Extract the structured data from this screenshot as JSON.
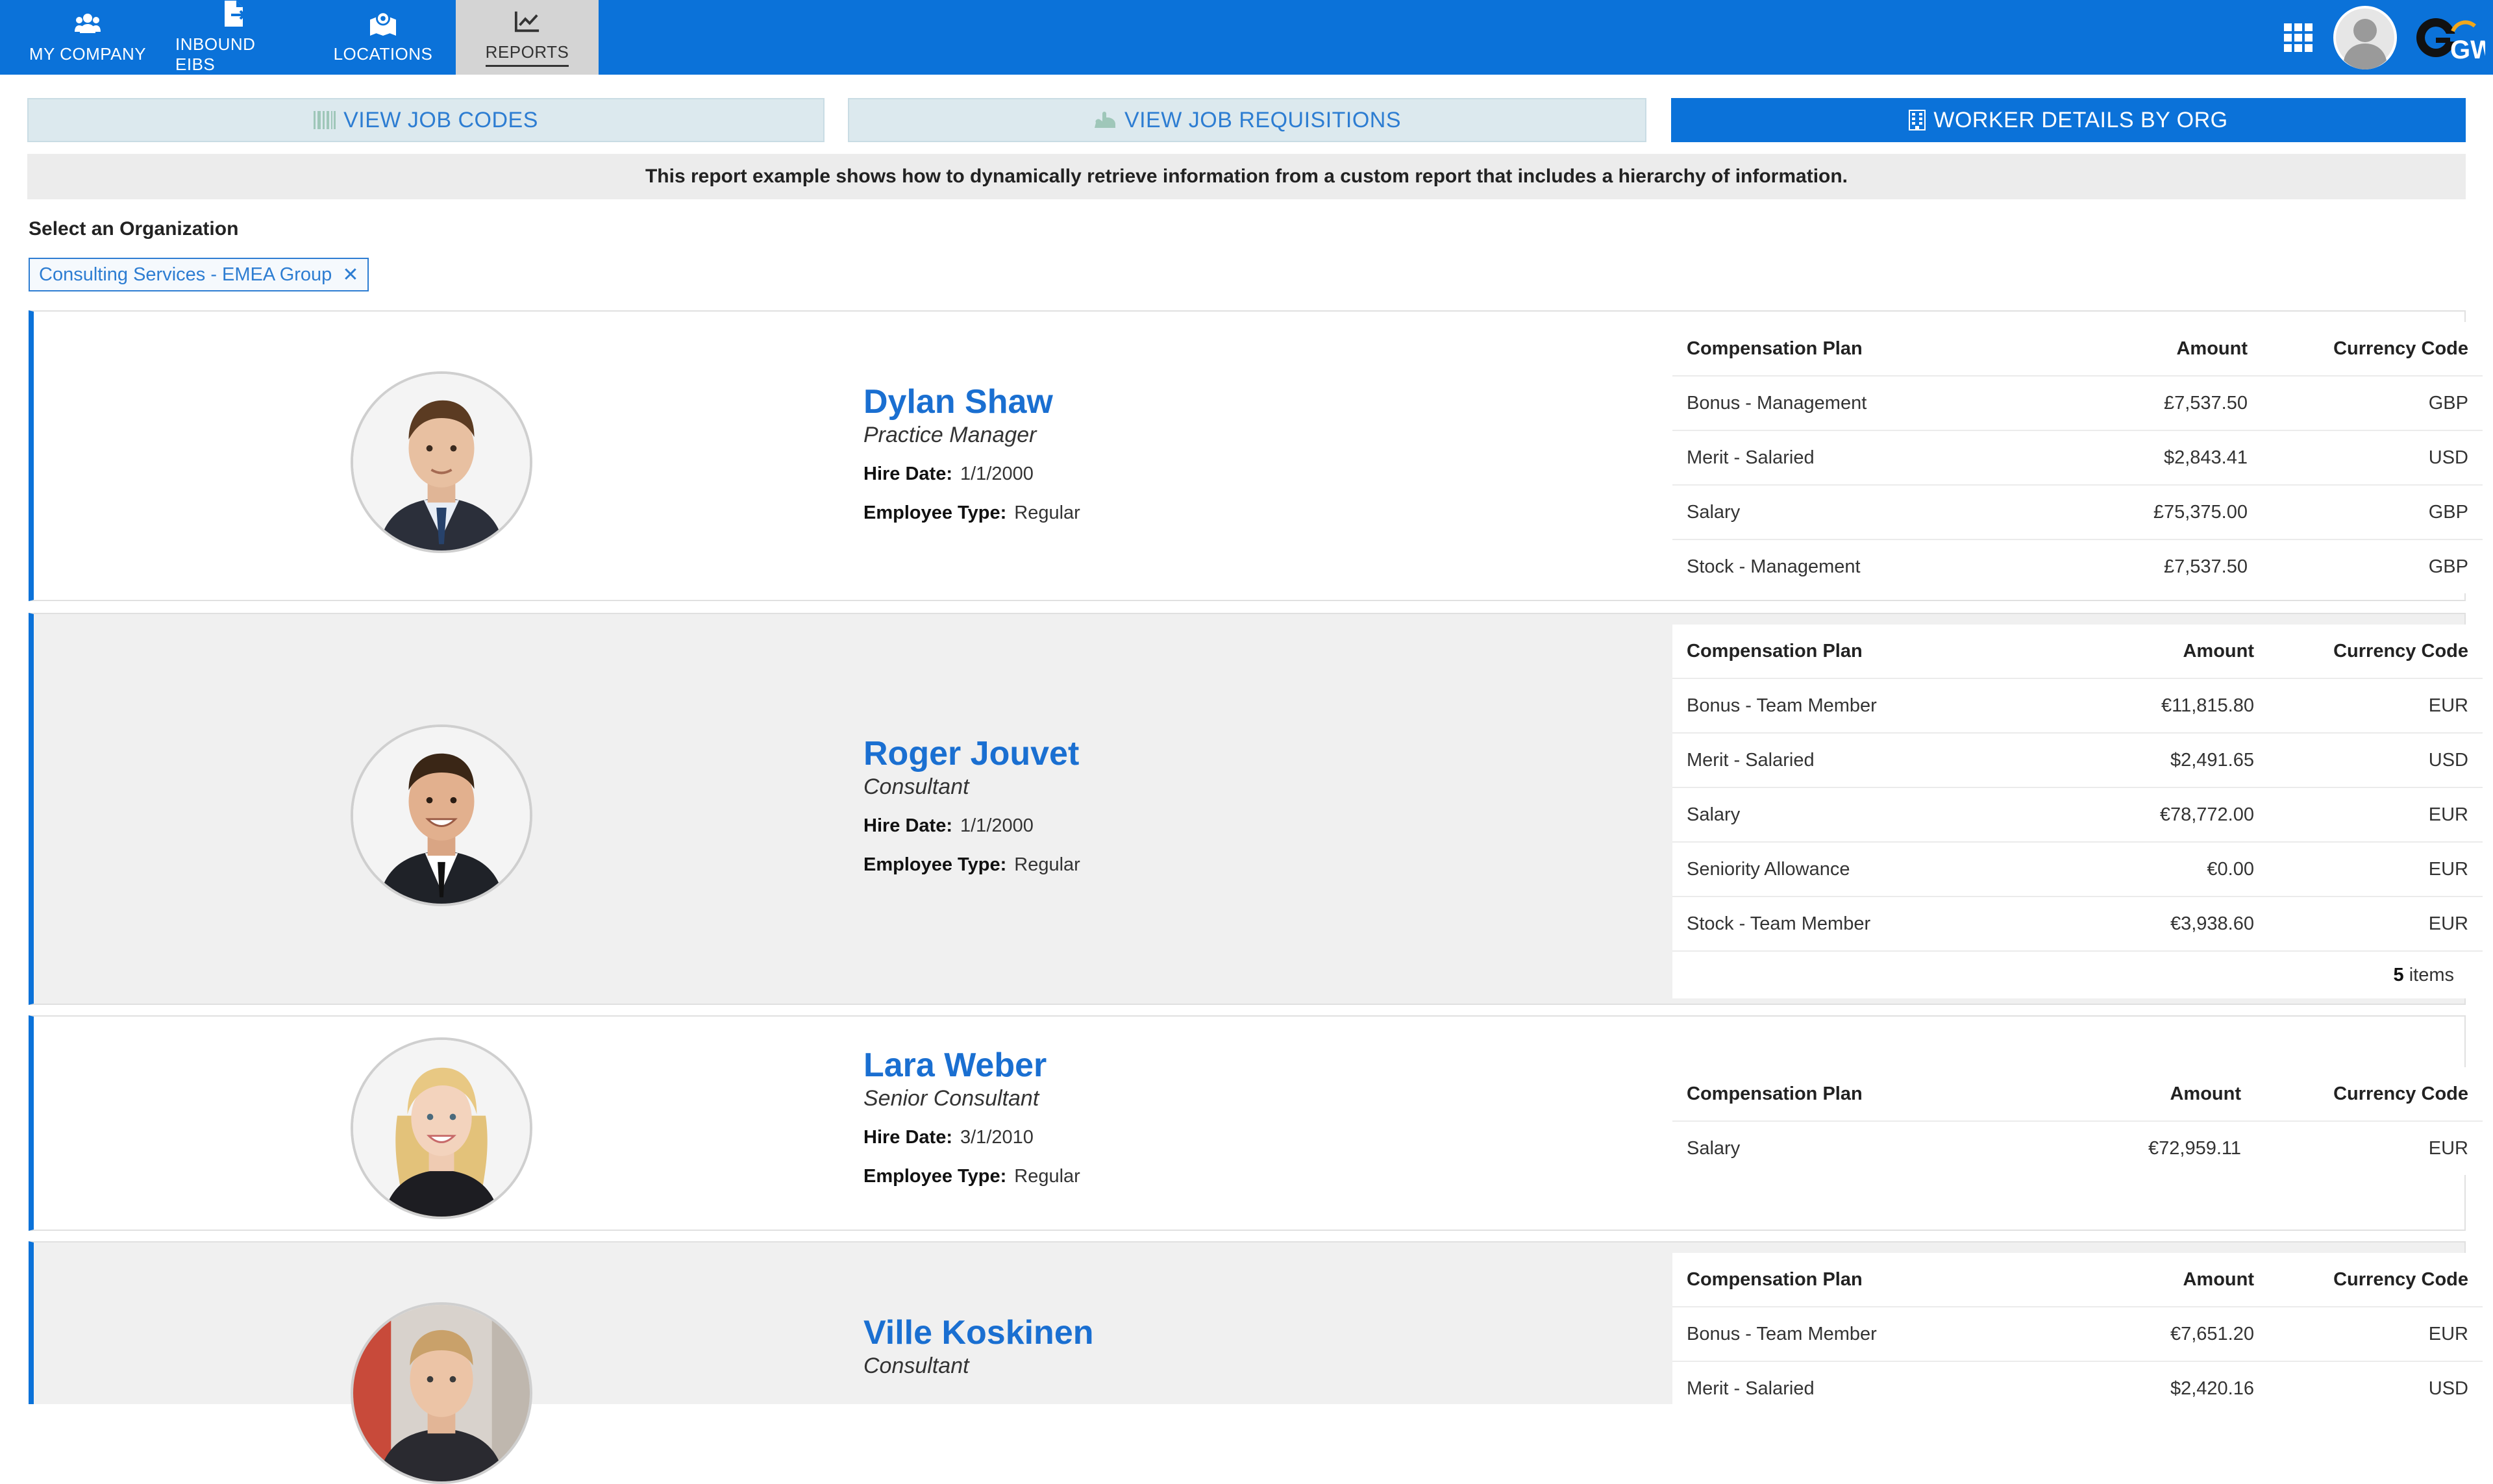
{
  "nav": {
    "items": [
      {
        "label": "MY COMPANY",
        "icon": "users-icon"
      },
      {
        "label": "INBOUND EIBS",
        "icon": "file-import-icon"
      },
      {
        "label": "LOCATIONS",
        "icon": "map-location-icon"
      },
      {
        "label": "REPORTS",
        "icon": "chart-line-icon",
        "active": true
      }
    ],
    "right_icons": [
      "apps-grid-icon",
      "user-avatar",
      "gw-logo"
    ],
    "logo_text": "GW"
  },
  "tabs": [
    {
      "label": "VIEW JOB CODES",
      "icon": "barcode-icon",
      "active": false
    },
    {
      "label": "VIEW JOB REQUISITIONS",
      "icon": "hand-icon",
      "active": false
    },
    {
      "label": "WORKER DETAILS BY ORG",
      "icon": "building-icon",
      "active": true
    }
  ],
  "info_text": "This report example shows how to dynamically retrieve information from a custom report that includes a hierarchy of information.",
  "org_select": {
    "label": "Select an Organization",
    "selected": "Consulting Services - EMEA Group",
    "remove_icon": "close-icon"
  },
  "labels": {
    "hire_date": "Hire Date:",
    "employee_type": "Employee Type:",
    "col_plan": "Compensation Plan",
    "col_amount": "Amount",
    "col_currency": "Currency Code",
    "items_suffix": "items"
  },
  "workers": [
    {
      "name": "Dylan Shaw",
      "title": "Practice Manager",
      "hire_date": "1/1/2000",
      "employee_type": "Regular",
      "compensation": [
        {
          "plan": "Bonus - Management",
          "amount": "£7,537.50",
          "currency": "GBP"
        },
        {
          "plan": "Merit - Salaried",
          "amount": "$2,843.41",
          "currency": "USD"
        },
        {
          "plan": "Salary",
          "amount": "£75,375.00",
          "currency": "GBP"
        },
        {
          "plan": "Stock - Management",
          "amount": "£7,537.50",
          "currency": "GBP"
        }
      ]
    },
    {
      "name": "Roger Jouvet",
      "title": "Consultant",
      "hire_date": "1/1/2000",
      "employee_type": "Regular",
      "compensation": [
        {
          "plan": "Bonus - Team Member",
          "amount": "€11,815.80",
          "currency": "EUR"
        },
        {
          "plan": "Merit - Salaried",
          "amount": "$2,491.65",
          "currency": "USD"
        },
        {
          "plan": "Salary",
          "amount": "€78,772.00",
          "currency": "EUR"
        },
        {
          "plan": "Seniority Allowance",
          "amount": "€0.00",
          "currency": "EUR"
        },
        {
          "plan": "Stock - Team Member",
          "amount": "€3,938.60",
          "currency": "EUR"
        }
      ],
      "item_count": "5"
    },
    {
      "name": "Lara Weber",
      "title": "Senior Consultant",
      "hire_date": "3/1/2010",
      "employee_type": "Regular",
      "compensation": [
        {
          "plan": "Salary",
          "amount": "€72,959.11",
          "currency": "EUR"
        }
      ]
    },
    {
      "name": "Ville Koskinen",
      "title": "Consultant",
      "compensation": [
        {
          "plan": "Bonus - Team Member",
          "amount": "€7,651.20",
          "currency": "EUR"
        },
        {
          "plan": "Merit - Salaried",
          "amount": "$2,420.16",
          "currency": "USD"
        }
      ]
    }
  ]
}
